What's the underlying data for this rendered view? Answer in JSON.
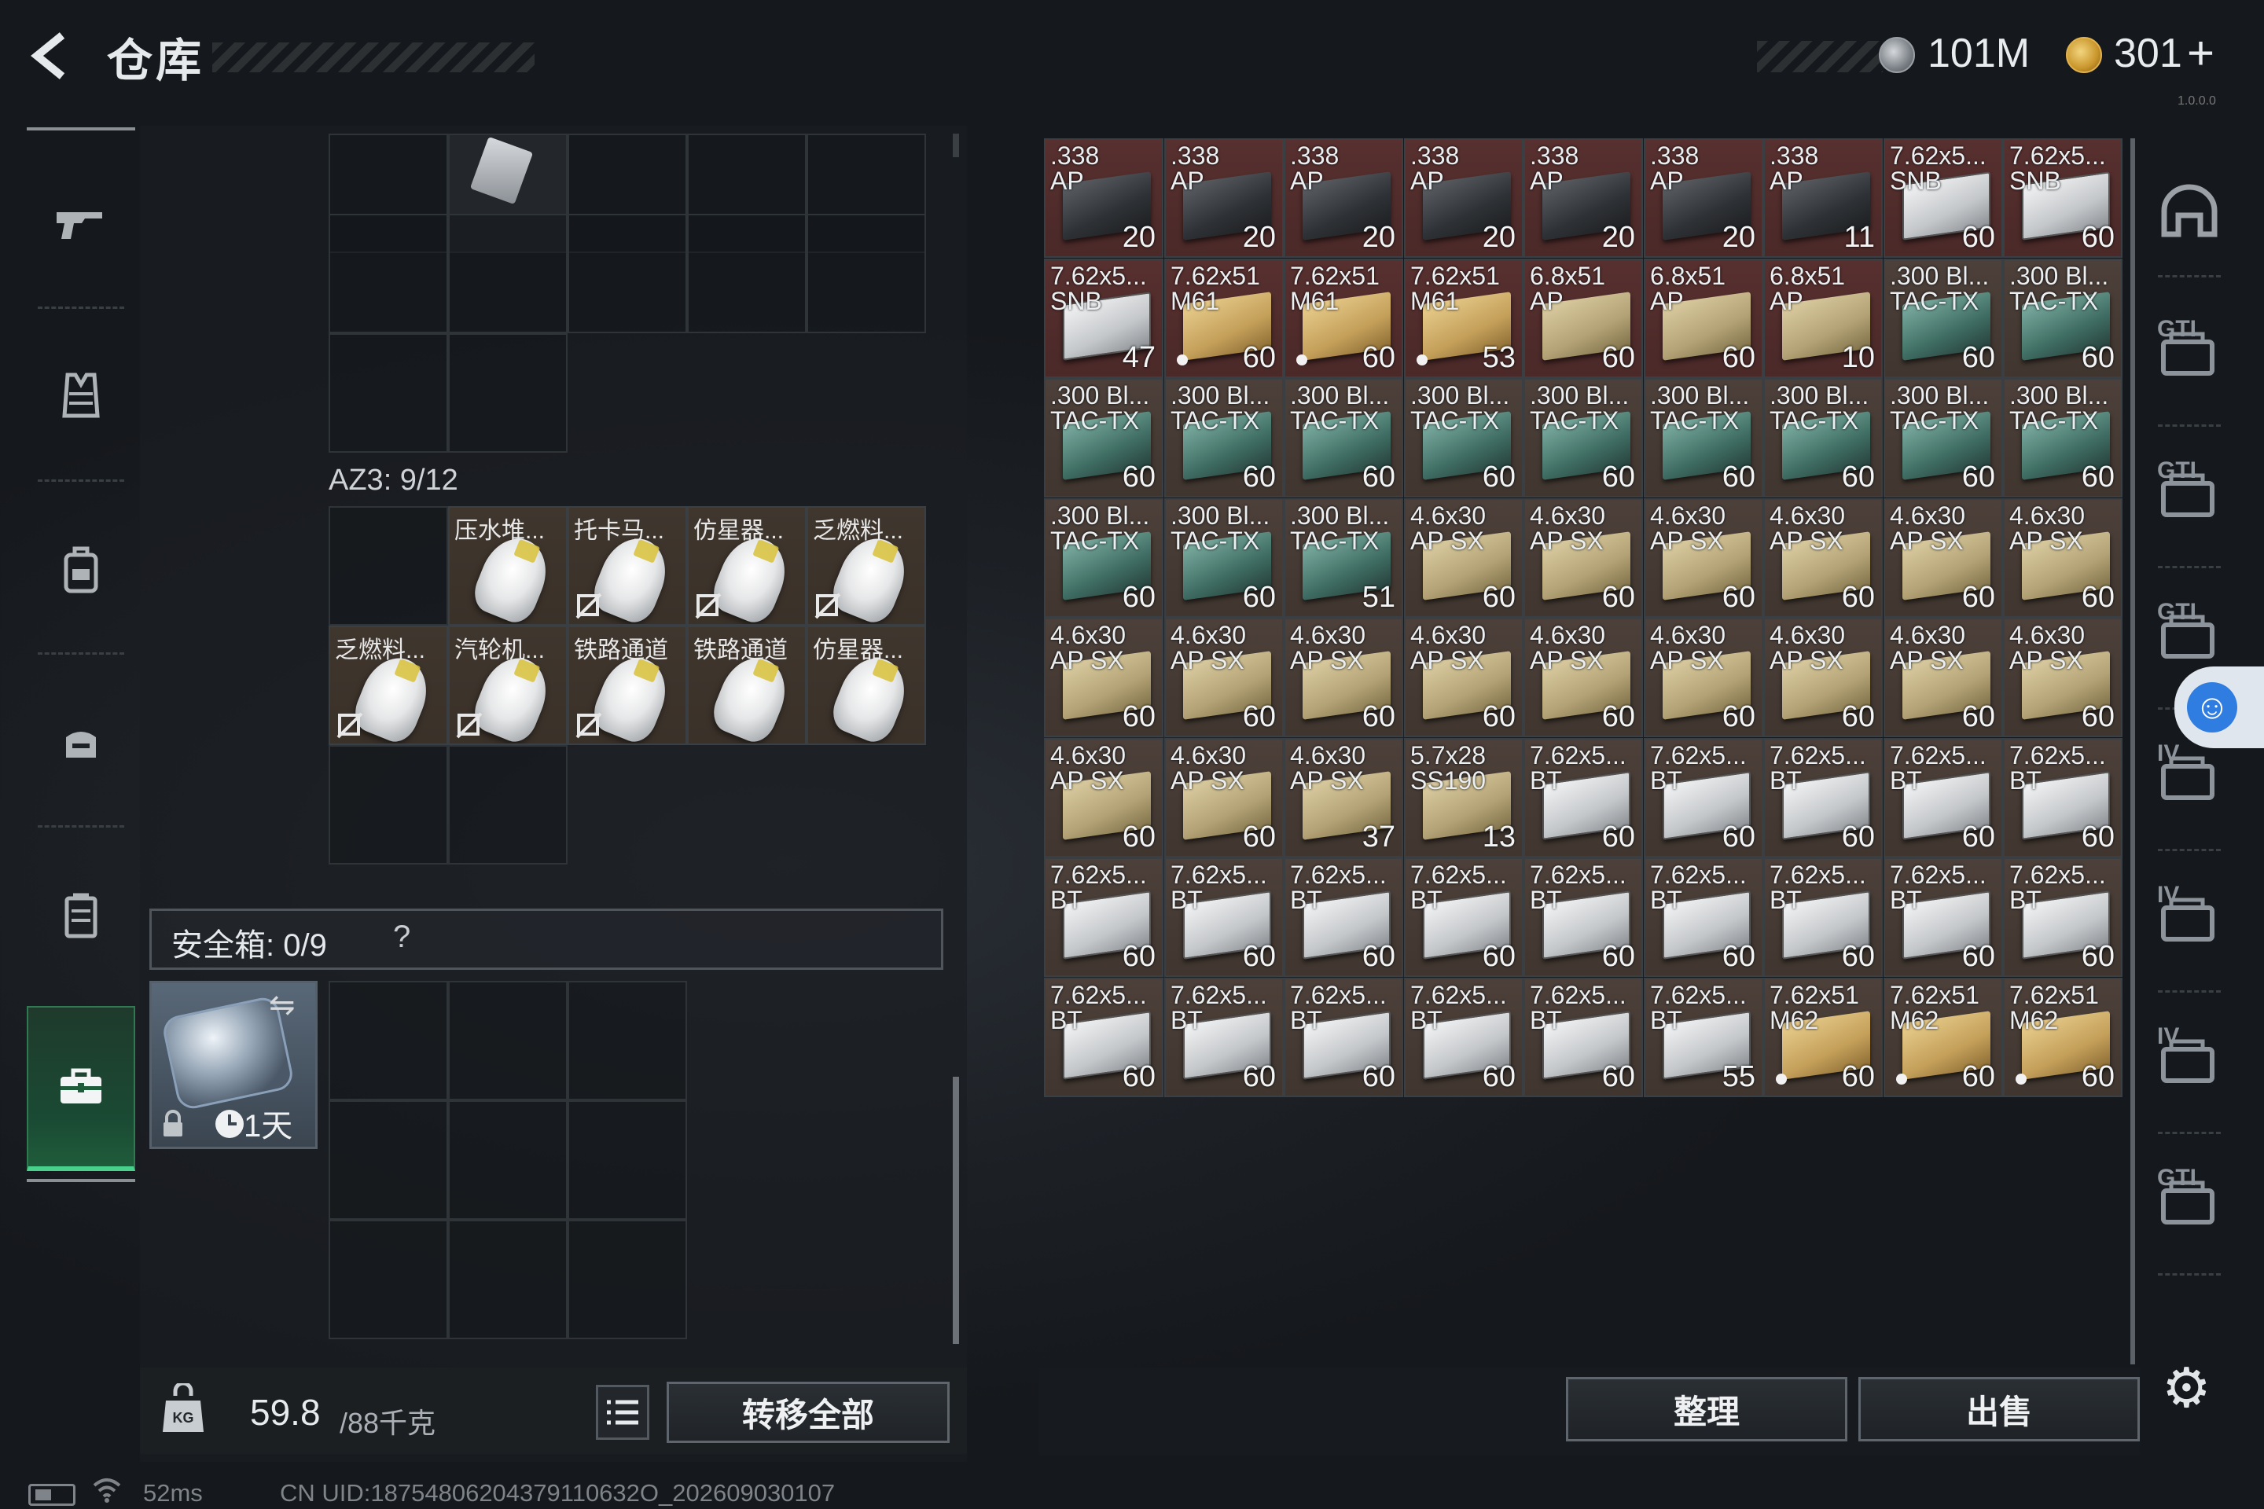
{
  "header": {
    "title": "仓库",
    "currency_silver": "101M",
    "currency_gold": "301",
    "plus": "+",
    "version": "1.0.0.0"
  },
  "left_nav": {
    "items": [
      {
        "name": "weapon-icon"
      },
      {
        "name": "vest-icon"
      },
      {
        "name": "backpack-icon"
      },
      {
        "name": "rig-icon"
      },
      {
        "name": "container-icon"
      },
      {
        "name": "safe-case-icon",
        "active": true
      }
    ]
  },
  "left_panel": {
    "container_label": "AZ3: 9/12",
    "az3_items": [
      {
        "name": "压水堆..."
      },
      {
        "name": "托卡马..."
      },
      {
        "name": "仿星器..."
      },
      {
        "name": "乏燃料..."
      },
      {
        "name": "乏燃料..."
      },
      {
        "name": "汽轮机..."
      },
      {
        "name": "铁路通道"
      },
      {
        "name": "铁路通道"
      },
      {
        "name": "仿星器..."
      }
    ],
    "safe_label": "安全箱: 0/9",
    "safe_help": "?",
    "safebox_time": "1天"
  },
  "bottom_left": {
    "weight_value": "59.8",
    "weight_max": "/88千克",
    "transfer_all": "转移全部"
  },
  "status": {
    "ping": "52ms",
    "uid": "CN UID:18754806204379110632O_202609030107"
  },
  "right_grid": {
    "items": [
      {
        "l1": ".338",
        "l2": "AP",
        "q": "20",
        "bg": "red",
        "box": "dark"
      },
      {
        "l1": ".338",
        "l2": "AP",
        "q": "20",
        "bg": "red",
        "box": "dark"
      },
      {
        "l1": ".338",
        "l2": "AP",
        "q": "20",
        "bg": "red",
        "box": "dark"
      },
      {
        "l1": ".338",
        "l2": "AP",
        "q": "20",
        "bg": "red",
        "box": "dark"
      },
      {
        "l1": ".338",
        "l2": "AP",
        "q": "20",
        "bg": "red",
        "box": "dark"
      },
      {
        "l1": ".338",
        "l2": "AP",
        "q": "20",
        "bg": "red",
        "box": "dark"
      },
      {
        "l1": ".338",
        "l2": "AP",
        "q": "11",
        "bg": "red",
        "box": "dark"
      },
      {
        "l1": "7.62x5...",
        "l2": "SNB",
        "q": "60",
        "bg": "red",
        "box": "white"
      },
      {
        "l1": "7.62x5...",
        "l2": "SNB",
        "q": "60",
        "bg": "red",
        "box": "white"
      },
      {
        "l1": "7.62x5...",
        "l2": "SNB",
        "q": "47",
        "bg": "red",
        "box": "white"
      },
      {
        "l1": "7.62x51",
        "l2": "M61",
        "q": "60",
        "bg": "red",
        "box": "gold",
        "dot": true
      },
      {
        "l1": "7.62x51",
        "l2": "M61",
        "q": "60",
        "bg": "red",
        "box": "gold",
        "dot": true
      },
      {
        "l1": "7.62x51",
        "l2": "M61",
        "q": "53",
        "bg": "red",
        "box": "gold",
        "dot": true
      },
      {
        "l1": "6.8x51",
        "l2": "AP",
        "q": "60",
        "bg": "red",
        "box": "tan"
      },
      {
        "l1": "6.8x51",
        "l2": "AP",
        "q": "60",
        "bg": "red",
        "box": "tan"
      },
      {
        "l1": "6.8x51",
        "l2": "AP",
        "q": "10",
        "bg": "red",
        "box": "tan"
      },
      {
        "l1": ".300 Bl...",
        "l2": "TAC-TX",
        "q": "60",
        "bg": "brown",
        "box": "teal"
      },
      {
        "l1": ".300 Bl...",
        "l2": "TAC-TX",
        "q": "60",
        "bg": "brown",
        "box": "teal"
      },
      {
        "l1": ".300 Bl...",
        "l2": "TAC-TX",
        "q": "60",
        "bg": "brown",
        "box": "teal"
      },
      {
        "l1": ".300 Bl...",
        "l2": "TAC-TX",
        "q": "60",
        "bg": "brown",
        "box": "teal"
      },
      {
        "l1": ".300 Bl...",
        "l2": "TAC-TX",
        "q": "60",
        "bg": "brown",
        "box": "teal"
      },
      {
        "l1": ".300 Bl...",
        "l2": "TAC-TX",
        "q": "60",
        "bg": "brown",
        "box": "teal"
      },
      {
        "l1": ".300 Bl...",
        "l2": "TAC-TX",
        "q": "60",
        "bg": "brown",
        "box": "teal"
      },
      {
        "l1": ".300 Bl...",
        "l2": "TAC-TX",
        "q": "60",
        "bg": "brown",
        "box": "teal"
      },
      {
        "l1": ".300 Bl...",
        "l2": "TAC-TX",
        "q": "60",
        "bg": "brown",
        "box": "teal"
      },
      {
        "l1": ".300 Bl...",
        "l2": "TAC-TX",
        "q": "60",
        "bg": "brown",
        "box": "teal"
      },
      {
        "l1": ".300 Bl...",
        "l2": "TAC-TX",
        "q": "60",
        "bg": "brown",
        "box": "teal"
      },
      {
        "l1": ".300 Bl...",
        "l2": "TAC-TX",
        "q": "60",
        "bg": "brown",
        "box": "teal"
      },
      {
        "l1": ".300 Bl...",
        "l2": "TAC-TX",
        "q": "60",
        "bg": "brown",
        "box": "teal"
      },
      {
        "l1": ".300 Bl...",
        "l2": "TAC-TX",
        "q": "51",
        "bg": "brown",
        "box": "teal"
      },
      {
        "l1": "4.6x30",
        "l2": "AP SX",
        "q": "60",
        "bg": "brown",
        "box": "tan"
      },
      {
        "l1": "4.6x30",
        "l2": "AP SX",
        "q": "60",
        "bg": "brown",
        "box": "tan"
      },
      {
        "l1": "4.6x30",
        "l2": "AP SX",
        "q": "60",
        "bg": "brown",
        "box": "tan"
      },
      {
        "l1": "4.6x30",
        "l2": "AP SX",
        "q": "60",
        "bg": "brown",
        "box": "tan"
      },
      {
        "l1": "4.6x30",
        "l2": "AP SX",
        "q": "60",
        "bg": "brown",
        "box": "tan"
      },
      {
        "l1": "4.6x30",
        "l2": "AP SX",
        "q": "60",
        "bg": "brown",
        "box": "tan"
      },
      {
        "l1": "4.6x30",
        "l2": "AP SX",
        "q": "60",
        "bg": "brown",
        "box": "tan"
      },
      {
        "l1": "4.6x30",
        "l2": "AP SX",
        "q": "60",
        "bg": "brown",
        "box": "tan"
      },
      {
        "l1": "4.6x30",
        "l2": "AP SX",
        "q": "60",
        "bg": "brown",
        "box": "tan"
      },
      {
        "l1": "4.6x30",
        "l2": "AP SX",
        "q": "60",
        "bg": "brown",
        "box": "tan"
      },
      {
        "l1": "4.6x30",
        "l2": "AP SX",
        "q": "60",
        "bg": "brown",
        "box": "tan"
      },
      {
        "l1": "4.6x30",
        "l2": "AP SX",
        "q": "60",
        "bg": "brown",
        "box": "tan"
      },
      {
        "l1": "4.6x30",
        "l2": "AP SX",
        "q": "60",
        "bg": "brown",
        "box": "tan"
      },
      {
        "l1": "4.6x30",
        "l2": "AP SX",
        "q": "60",
        "bg": "brown",
        "box": "tan"
      },
      {
        "l1": "4.6x30",
        "l2": "AP SX",
        "q": "60",
        "bg": "brown",
        "box": "tan"
      },
      {
        "l1": "4.6x30",
        "l2": "AP SX",
        "q": "60",
        "bg": "brown",
        "box": "tan"
      },
      {
        "l1": "4.6x30",
        "l2": "AP SX",
        "q": "60",
        "bg": "brown",
        "box": "tan"
      },
      {
        "l1": "4.6x30",
        "l2": "AP SX",
        "q": "37",
        "bg": "brown",
        "box": "tan"
      },
      {
        "l1": "5.7x28",
        "l2": "SS190",
        "q": "13",
        "bg": "brown",
        "box": "tan"
      },
      {
        "l1": "7.62x5...",
        "l2": "BT",
        "q": "60",
        "bg": "brown",
        "box": "white"
      },
      {
        "l1": "7.62x5...",
        "l2": "BT",
        "q": "60",
        "bg": "brown",
        "box": "white"
      },
      {
        "l1": "7.62x5...",
        "l2": "BT",
        "q": "60",
        "bg": "brown",
        "box": "white"
      },
      {
        "l1": "7.62x5...",
        "l2": "BT",
        "q": "60",
        "bg": "brown",
        "box": "white"
      },
      {
        "l1": "7.62x5...",
        "l2": "BT",
        "q": "60",
        "bg": "brown",
        "box": "white"
      },
      {
        "l1": "7.62x5...",
        "l2": "BT",
        "q": "60",
        "bg": "brown",
        "box": "white"
      },
      {
        "l1": "7.62x5...",
        "l2": "BT",
        "q": "60",
        "bg": "brown",
        "box": "white"
      },
      {
        "l1": "7.62x5...",
        "l2": "BT",
        "q": "60",
        "bg": "brown",
        "box": "white"
      },
      {
        "l1": "7.62x5...",
        "l2": "BT",
        "q": "60",
        "bg": "brown",
        "box": "white"
      },
      {
        "l1": "7.62x5...",
        "l2": "BT",
        "q": "60",
        "bg": "brown",
        "box": "white"
      },
      {
        "l1": "7.62x5...",
        "l2": "BT",
        "q": "60",
        "bg": "brown",
        "box": "white"
      },
      {
        "l1": "7.62x5...",
        "l2": "BT",
        "q": "60",
        "bg": "brown",
        "box": "white"
      },
      {
        "l1": "7.62x5...",
        "l2": "BT",
        "q": "60",
        "bg": "brown",
        "box": "white"
      },
      {
        "l1": "7.62x5...",
        "l2": "BT",
        "q": "60",
        "bg": "brown",
        "box": "white"
      },
      {
        "l1": "7.62x5...",
        "l2": "BT",
        "q": "60",
        "bg": "brown",
        "box": "white"
      },
      {
        "l1": "7.62x5...",
        "l2": "BT",
        "q": "60",
        "bg": "brown",
        "box": "white"
      },
      {
        "l1": "7.62x5...",
        "l2": "BT",
        "q": "60",
        "bg": "brown",
        "box": "white"
      },
      {
        "l1": "7.62x5...",
        "l2": "BT",
        "q": "60",
        "bg": "brown",
        "box": "white"
      },
      {
        "l1": "7.62x5...",
        "l2": "BT",
        "q": "60",
        "bg": "brown",
        "box": "white"
      },
      {
        "l1": "7.62x5...",
        "l2": "BT",
        "q": "55",
        "bg": "brown",
        "box": "white"
      },
      {
        "l1": "7.62x51",
        "l2": "M62",
        "q": "60",
        "bg": "brown",
        "box": "gold",
        "dot": true
      },
      {
        "l1": "7.62x51",
        "l2": "M62",
        "q": "60",
        "bg": "brown",
        "box": "gold",
        "dot": true
      },
      {
        "l1": "7.62x51",
        "l2": "M62",
        "q": "60",
        "bg": "brown",
        "box": "gold",
        "dot": true
      }
    ]
  },
  "right_sidebar": {
    "tabs": [
      {
        "name": "helmet-tab-icon",
        "label": ""
      },
      {
        "name": "gti-weapon-tab-icon",
        "label": "GTI"
      },
      {
        "name": "gti-equipment-tab-icon",
        "label": "GTI"
      },
      {
        "name": "gti-ammo-tab-icon",
        "label": "GTI"
      },
      {
        "name": "iv-medical-tab-icon",
        "label": "IV"
      },
      {
        "name": "iv-folder-tab-icon",
        "label": "IV"
      },
      {
        "name": "iv-folder2-tab-icon",
        "label": "IV"
      },
      {
        "name": "gti-misc-tab-icon",
        "label": "GTI"
      }
    ]
  },
  "bottom_right": {
    "sort": "整理",
    "sell": "出售"
  },
  "colors": {
    "accent_green": "#49d08a",
    "row_red": "#57302f",
    "row_brown": "#4d403a",
    "access_blue": "#2f7de0"
  }
}
